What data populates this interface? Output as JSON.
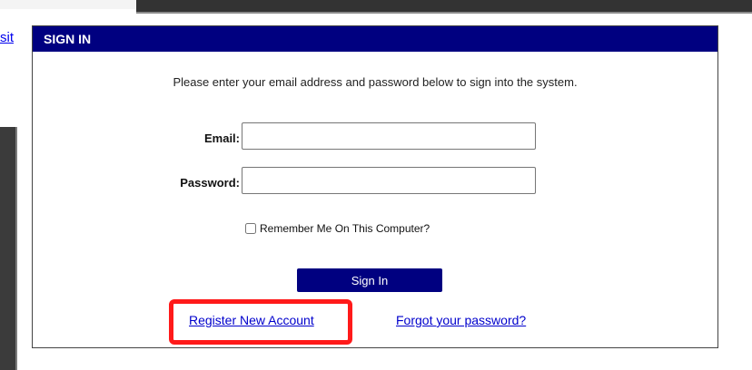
{
  "left_link": {
    "text": "sit"
  },
  "panel": {
    "title": "SIGN IN",
    "intro": "Please enter your email address and password below to sign into the system.",
    "email": {
      "label": "Email:",
      "value": "",
      "placeholder": ""
    },
    "password": {
      "label": "Password:",
      "value": "",
      "placeholder": ""
    },
    "remember": {
      "label": "Remember Me On This Computer?",
      "checked": false
    },
    "sign_in_label": "Sign In",
    "register_link": "Register New Account",
    "forgot_link": "Forgot your password?"
  },
  "colors": {
    "header_bg": "#000080",
    "button_bg": "#000080",
    "link": "#0000cc",
    "highlight": "#ff1a1a"
  }
}
